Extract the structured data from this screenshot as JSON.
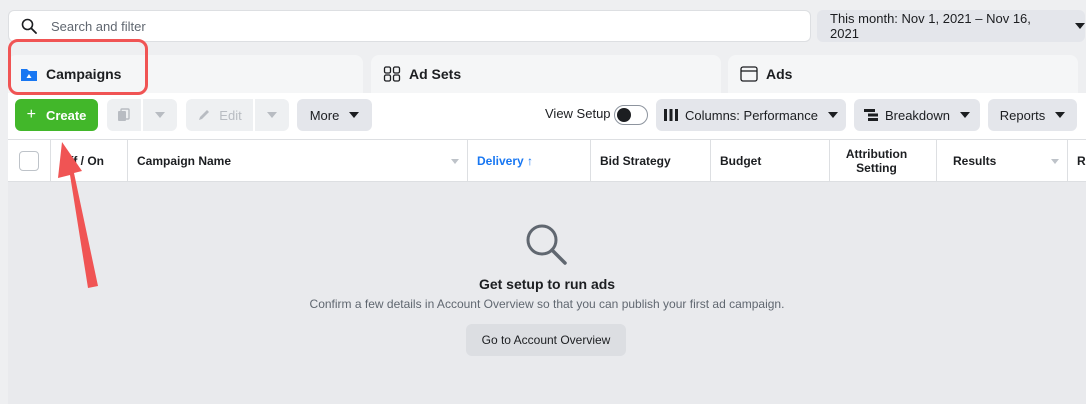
{
  "search": {
    "placeholder": "Search and filter"
  },
  "date_range": {
    "label": "This month: Nov 1, 2021 – Nov 16, 2021"
  },
  "tabs": [
    {
      "label": "Campaigns",
      "icon": "folder-icon",
      "active": true
    },
    {
      "label": "Ad Sets",
      "icon": "grid-icon",
      "active": false
    },
    {
      "label": "Ads",
      "icon": "ad-window-icon",
      "active": false
    }
  ],
  "toolbar": {
    "create_label": "Create",
    "edit_label": "Edit",
    "more_label": "More",
    "view_setup_label": "View Setup",
    "columns_label": "Columns: Performance",
    "breakdown_label": "Breakdown",
    "reports_label": "Reports"
  },
  "table": {
    "columns": [
      "Off / On",
      "Campaign Name",
      "Delivery ↑",
      "Bid Strategy",
      "Budget",
      "Attribution Setting",
      "Results",
      "Re"
    ]
  },
  "empty_state": {
    "title": "Get setup to run ads",
    "description": "Confirm a few details in Account Overview so that you can publish your first ad campaign.",
    "button_label": "Go to Account Overview"
  },
  "colors": {
    "accent": "#1877f2",
    "create": "#42b72a",
    "annotation": "#f05454"
  }
}
